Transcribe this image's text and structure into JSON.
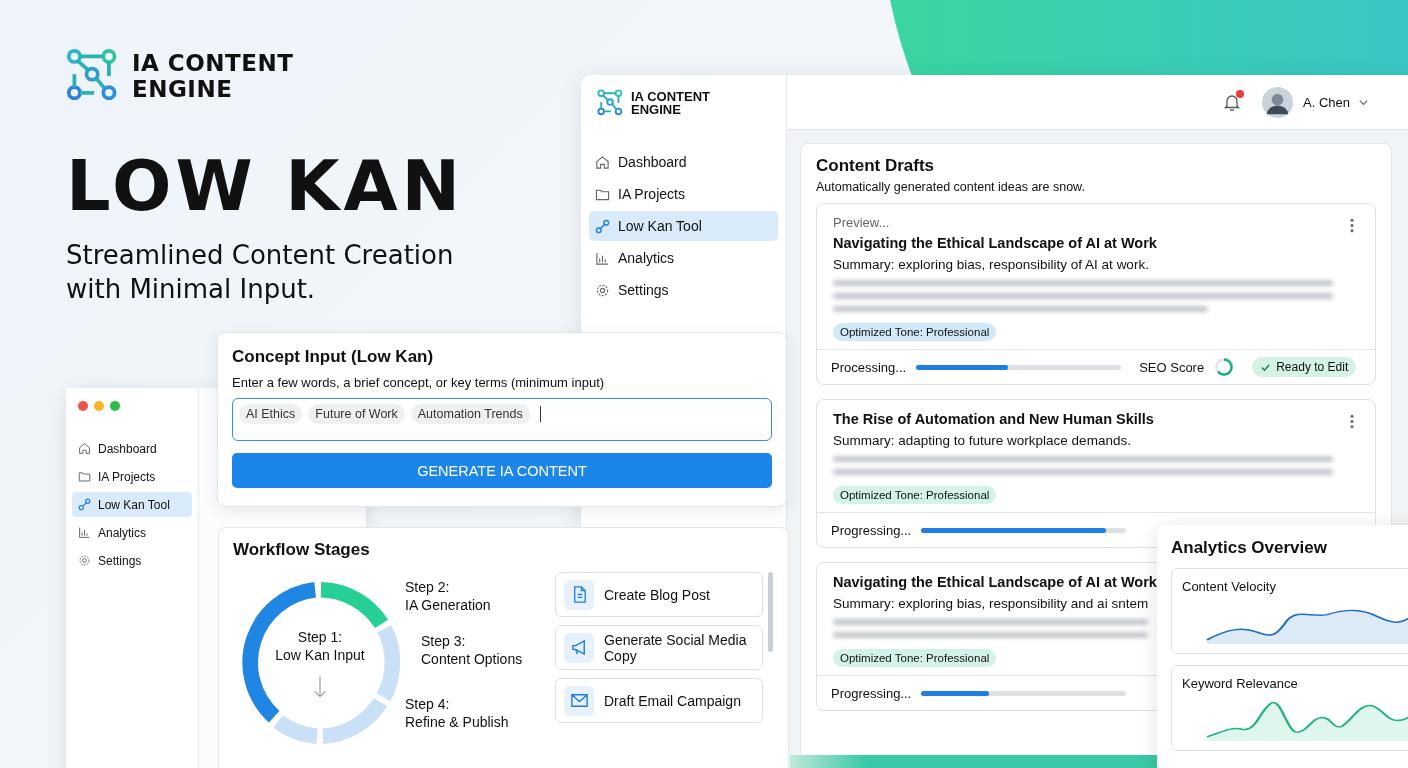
{
  "brand": {
    "lines": [
      "IA CONTENT",
      "ENGINE"
    ]
  },
  "hero": {
    "title": "LOW KAN",
    "tagline_lines": [
      "Streamlined Content Creation",
      "with Minimal Input."
    ]
  },
  "main_window": {
    "brand": {
      "lines": [
        "IA CONTENT",
        "ENGINE"
      ]
    },
    "sidebar": [
      {
        "label": "Dashboard",
        "kind": "home",
        "selected": false
      },
      {
        "label": "IA Projects",
        "kind": "folder",
        "selected": false
      },
      {
        "label": "Low Kan Tool",
        "kind": "link",
        "selected": true
      },
      {
        "label": "Analytics",
        "kind": "chart",
        "selected": false
      },
      {
        "label": "Settings",
        "kind": "gear",
        "selected": false
      }
    ],
    "header": {
      "notification_unread": true,
      "user": "A. Chen"
    },
    "content_drafts": {
      "title": "Content Drafts",
      "subtitle": "Automatically generated content ideas are snow.",
      "cards": [
        {
          "preview": "Preview...",
          "title": "Navigating the Ethical Landscape of AI at Work",
          "summary": "Summary: exploring bias, responsibility of AI at work.",
          "tag": "Optimized Tone: Professional",
          "color": "#cfe9f8",
          "status": "Processing...",
          "level": 0.45,
          "seo_label": "SEO Score",
          "badge": "Ready to Edit"
        },
        {
          "title": "The Rise of Automation and New Human Skills",
          "summary": "Summary: adapting to future workplace demands.",
          "tag": "Optimized Tone: Professional",
          "color": "#d3f3e6",
          "status": "Progressing...",
          "level": 0.9
        },
        {
          "title": "Navigating the Ethical Landscape of AI at Work",
          "summary": "Summary: exploring bias, responsibility and ai sntem",
          "tag": "Optimized Tone: Professional",
          "color": "#d3f3e6",
          "status": "Progressing...",
          "level": 0.33
        }
      ]
    }
  },
  "small_window": {
    "sidebar": [
      {
        "label": "Dashboard",
        "kind": "home",
        "selected": false
      },
      {
        "label": "IA Projects",
        "kind": "folder",
        "selected": false
      },
      {
        "label": "Low Kan Tool",
        "kind": "link",
        "selected": true
      },
      {
        "label": "Analytics",
        "kind": "chart",
        "selected": false
      },
      {
        "label": "Settings",
        "kind": "gear",
        "selected": false
      }
    ]
  },
  "concept_input": {
    "title": "Concept Input (Low Kan)",
    "hint": "Enter a few words, a brief concept, or key terms (minimum input)",
    "tags": [
      "AI Ethics",
      "Future of Work",
      "Automation Trends"
    ],
    "button": "GENERATE IA CONTENT"
  },
  "workflow": {
    "title": "Workflow Stages",
    "center": [
      "Step 1:",
      "Low Kan Input"
    ],
    "steps": [
      {
        "step": "Step 2:",
        "name": "IA Generation"
      },
      {
        "step": "Step 3:",
        "name": "Content Options"
      },
      {
        "step": "Step 4:",
        "name": "Refine & Publish"
      }
    ],
    "actions": [
      {
        "label": "Create Blog Post",
        "kind": "document"
      },
      {
        "label": "Generate Social Media Copy",
        "kind": "megaphone"
      },
      {
        "label": "Draft Email Campaign",
        "kind": "mail"
      }
    ]
  },
  "analytics": {
    "title": "Analytics Overview",
    "cards": [
      {
        "title": "Content Velocity",
        "kind": "velocity"
      },
      {
        "title": "Keyword Relevance",
        "kind": "keyword"
      }
    ]
  }
}
